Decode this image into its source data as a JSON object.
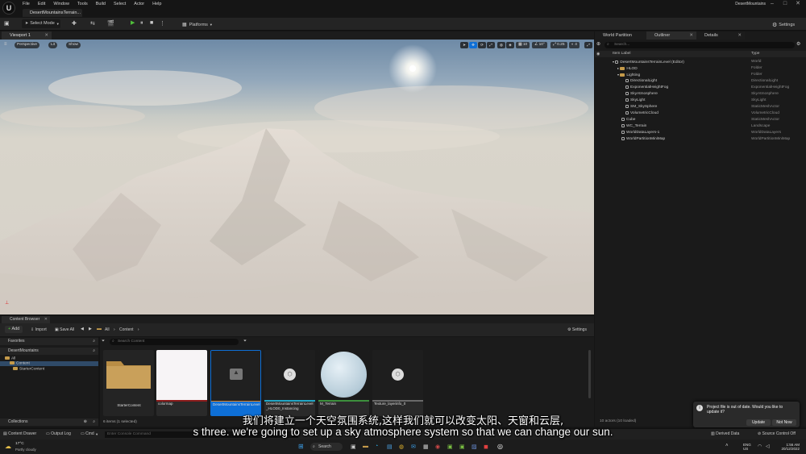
{
  "app": {
    "logo": "U",
    "menu": [
      "File",
      "Edit",
      "Window",
      "Tools",
      "Build",
      "Select",
      "Actor",
      "Help"
    ],
    "map_tab": "DesertMountainsTerrain...",
    "project_name": "DesertMountains"
  },
  "toolbar": {
    "select_mode": "Select Mode",
    "platforms": "Platforms",
    "settings": "Settings"
  },
  "viewport": {
    "tab": "Viewport 1",
    "perspective": "Perspective",
    "lit": "Lit",
    "show": "Show",
    "grid_snap": "10",
    "angle_snap": "10°",
    "scale_snap": "0.25",
    "camera_speed": "4"
  },
  "right_panel": {
    "tabs": [
      "World Partition",
      "Outliner",
      "Details"
    ],
    "search_placeholder": "Search...",
    "col_label": "Item Label",
    "col_type": "Type",
    "rows": [
      {
        "label": "DesertMountainsTerrainLevel (Editor)",
        "type": "World"
      },
      {
        "label": "HLOD",
        "type": "Folder"
      },
      {
        "label": "Lighting",
        "type": "Folder"
      },
      {
        "label": "DirectionalLight",
        "type": "DirectionalLight"
      },
      {
        "label": "ExponentialHeightFog",
        "type": "ExponentialHeightFog"
      },
      {
        "label": "SkyAtmosphere",
        "type": "SkyAtmosphere"
      },
      {
        "label": "SkyLight",
        "type": "SkyLight"
      },
      {
        "label": "SM_SkySphere",
        "type": "StaticMeshActor"
      },
      {
        "label": "VolumetricCloud",
        "type": "VolumetricCloud"
      },
      {
        "label": "Cube",
        "type": "StaticMeshActor"
      },
      {
        "label": "WC_Terrain",
        "type": "Landscape"
      },
      {
        "label": "WorldDataLayers-1",
        "type": "WorldDataLayers"
      },
      {
        "label": "WorldPartitionMiniMap",
        "type": "WorldPartitionMiniMap"
      }
    ],
    "footer": "10 actors (10 loaded)"
  },
  "content_browser": {
    "tab": "Content Browser",
    "add": "Add",
    "import": "Import",
    "save_all": "Save All",
    "path": [
      "All",
      "Content"
    ],
    "settings": "Settings",
    "search_placeholder": "Search Content",
    "favorites": "Favorites",
    "project": "DesertMountains",
    "tree": [
      "All",
      "Content",
      "StarterContent"
    ],
    "collections": "Collections",
    "item_count": "6 items (1 selected)",
    "assets": [
      {
        "name": "StarterContent"
      },
      {
        "name": "colormap"
      },
      {
        "name": "DesertMountainsTerrainLevel"
      },
      {
        "name": "DesertMountainsTerrainLevel_HLOD0_Instancing"
      },
      {
        "name": "M_Terrain"
      },
      {
        "name": "Texture_layerinfo_0"
      }
    ]
  },
  "status_bar": {
    "content_drawer": "Content Drawer",
    "output_log": "Output Log",
    "cmd": "Cmd",
    "console_placeholder": "Enter Console Command",
    "derived_data": "Derived Data",
    "source_control": "Source Control Off"
  },
  "popup": {
    "message": "Project file is out of date. Would you like to update it?",
    "update": "Update",
    "not_now": "Not Now"
  },
  "taskbar": {
    "temp": "17°C",
    "weather": "Partly cloudy",
    "search": "Search",
    "lang": "ENG",
    "region": "US",
    "time": "1:56 AM",
    "date": "20/12/2022"
  },
  "subtitles": {
    "zh": "我们将建立一个天空氛围系统,这样我们就可以改变太阳、天窗和云层,",
    "en": "s three. we're going to set up a sky atmosphere system so that we can change our sun."
  },
  "colors": {
    "accent_selected": "#0e6fd6",
    "play_green": "#4fbf3a",
    "folder": "#c49a4a"
  }
}
